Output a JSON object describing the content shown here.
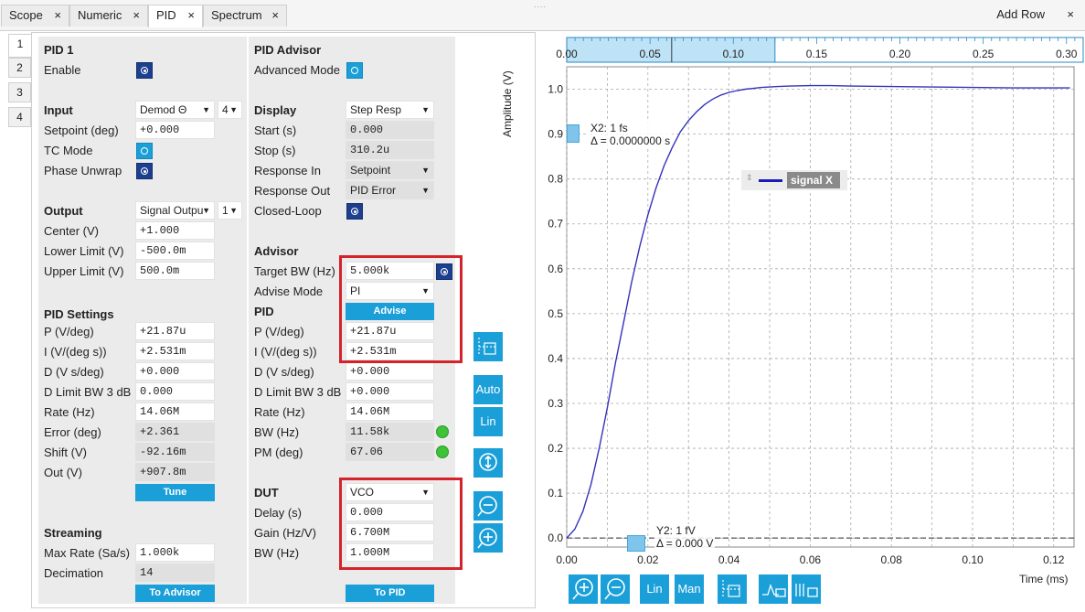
{
  "tabs": [
    {
      "label": "Scope"
    },
    {
      "label": "Numeric"
    },
    {
      "label": "PID"
    },
    {
      "label": "Spectrum"
    }
  ],
  "close_glyph": "×",
  "grip_glyph": "....",
  "add_row": "Add Row",
  "side_tabs": [
    "1",
    "2",
    "3",
    "4"
  ],
  "pid1": {
    "title": "PID 1",
    "enable_label": "Enable",
    "input_header": "Input",
    "input_value": "Demod Θ",
    "input_channel": "4",
    "setpoint_label": "Setpoint (deg)",
    "setpoint_value": "+0.000",
    "tc_mode_label": "TC Mode",
    "phase_unwrap_label": "Phase Unwrap",
    "output_header": "Output",
    "output_value": "Signal Outpu",
    "output_channel": "1",
    "center_label": "Center  (V)",
    "center_value": "+1.000",
    "lower_label": "Lower Limit  (V)",
    "lower_value": "-500.0m",
    "upper_label": "Upper Limit  (V)",
    "upper_value": "500.0m",
    "settings_header": "PID Settings",
    "p_label": "P (V/deg)",
    "p_value": "+21.87u",
    "i_label": "I (V/(deg s))",
    "i_value": "+2.531m",
    "d_label": "D (V s/deg)",
    "d_value": "+0.000",
    "dlimit_label": "D Limit BW 3 dB",
    "dlimit_value": "0.000",
    "rate_label": "Rate (Hz)",
    "rate_value": "14.06M",
    "error_label": "Error (deg)",
    "error_value": "+2.361",
    "shift_label": "Shift (V)",
    "shift_value": "-92.16m",
    "out_label": "Out  (V)",
    "out_value": "+907.8m",
    "tune_button": "Tune",
    "streaming_header": "Streaming",
    "maxrate_label": "Max Rate (Sa/s)",
    "maxrate_value": "1.000k",
    "decimation_label": "Decimation",
    "decimation_value": "14",
    "to_advisor_button": "To Advisor"
  },
  "advisor": {
    "title": "PID Advisor",
    "advanced_label": "Advanced Mode",
    "display_header": "Display",
    "display_value": "Step Resp",
    "start_label": "Start (s)",
    "start_value": "0.000",
    "stop_label": "Stop (s)",
    "stop_value": "310.2u",
    "resp_in_label": "Response In",
    "resp_in_value": "Setpoint",
    "resp_out_label": "Response Out",
    "resp_out_value": "PID Error",
    "closed_loop_label": "Closed-Loop",
    "advisor_header": "Advisor",
    "target_bw_label": "Target BW (Hz)",
    "target_bw_value": "5.000k",
    "advise_mode_label": "Advise Mode",
    "advise_mode_value": "PI",
    "advise_button": "Advise",
    "pid_header": "PID",
    "p_label": "P (V/deg)",
    "p_value": "+21.87u",
    "i_label": "I (V/(deg s))",
    "i_value": "+2.531m",
    "d_label": "D (V s/deg)",
    "d_value": "+0.000",
    "dlimit_label": "D Limit BW 3 dB",
    "dlimit_value": "+0.000",
    "rate_label": "Rate (Hz)",
    "rate_value": "14.06M",
    "bw_label": "BW (Hz)",
    "bw_value": "11.58k",
    "pm_label": "PM (deg)",
    "pm_value": "67.06",
    "dut_header": "DUT",
    "dut_value": "VCO",
    "delay_label": "Delay (s)",
    "delay_value": "0.000",
    "gain_label": "Gain (Hz/V)",
    "gain_value": "6.700M",
    "dut_bw_label": "BW (Hz)",
    "dut_bw_value": "1.000M",
    "to_pid_button": "To PID"
  },
  "toolbar": {
    "auto": "Auto",
    "lin": "Lin",
    "man": "Man",
    "lin_bottom": "Lin"
  },
  "colors": {
    "accent": "#1a9fd8",
    "checkbox_on": "#1c3f8f",
    "highlight_box": "#d4232b",
    "curve": "#3333bb",
    "led": "#3dc23a"
  },
  "cursors": {
    "x2_label": "X2: 1 fs",
    "x2_delta": "Δ = 0.0000000 s",
    "y2_label": "Y2: 1 fV",
    "y2_delta": "Δ = 0.000 V"
  },
  "chart_data": {
    "type": "line",
    "xlabel": "Time (ms)",
    "ylabel": "Amplitude (V)",
    "xlim": [
      0,
      0.125
    ],
    "ylim": [
      -0.02,
      1.05
    ],
    "x_ticks": [
      "0.00",
      "0.02",
      "0.04",
      "0.06",
      "0.08",
      "0.10",
      "0.12"
    ],
    "y_ticks": [
      "0.0",
      "0.1",
      "0.2",
      "0.3",
      "0.4",
      "0.5",
      "0.6",
      "0.7",
      "0.8",
      "0.9",
      "1.0"
    ],
    "overview_ticks": [
      "0.00",
      "0.05",
      "0.10",
      "0.15",
      "0.20",
      "0.25",
      "0.30"
    ],
    "grid": true,
    "legend": "top-center",
    "series": [
      {
        "name": "signal X",
        "x": [
          0,
          0.002,
          0.004,
          0.006,
          0.008,
          0.01,
          0.012,
          0.014,
          0.016,
          0.018,
          0.02,
          0.022,
          0.024,
          0.026,
          0.028,
          0.03,
          0.032,
          0.034,
          0.036,
          0.038,
          0.04,
          0.042,
          0.044,
          0.046,
          0.048,
          0.05,
          0.052,
          0.055,
          0.06,
          0.065,
          0.07,
          0.08,
          0.09,
          0.1,
          0.11,
          0.12,
          0.124
        ],
        "values": [
          0.0,
          0.02,
          0.06,
          0.12,
          0.2,
          0.29,
          0.39,
          0.48,
          0.57,
          0.65,
          0.72,
          0.78,
          0.83,
          0.87,
          0.905,
          0.93,
          0.95,
          0.966,
          0.978,
          0.987,
          0.993,
          0.997,
          1.0,
          1.002,
          1.004,
          1.005,
          1.006,
          1.007,
          1.008,
          1.008,
          1.007,
          1.006,
          1.005,
          1.004,
          1.003,
          1.003,
          1.003
        ]
      }
    ]
  }
}
